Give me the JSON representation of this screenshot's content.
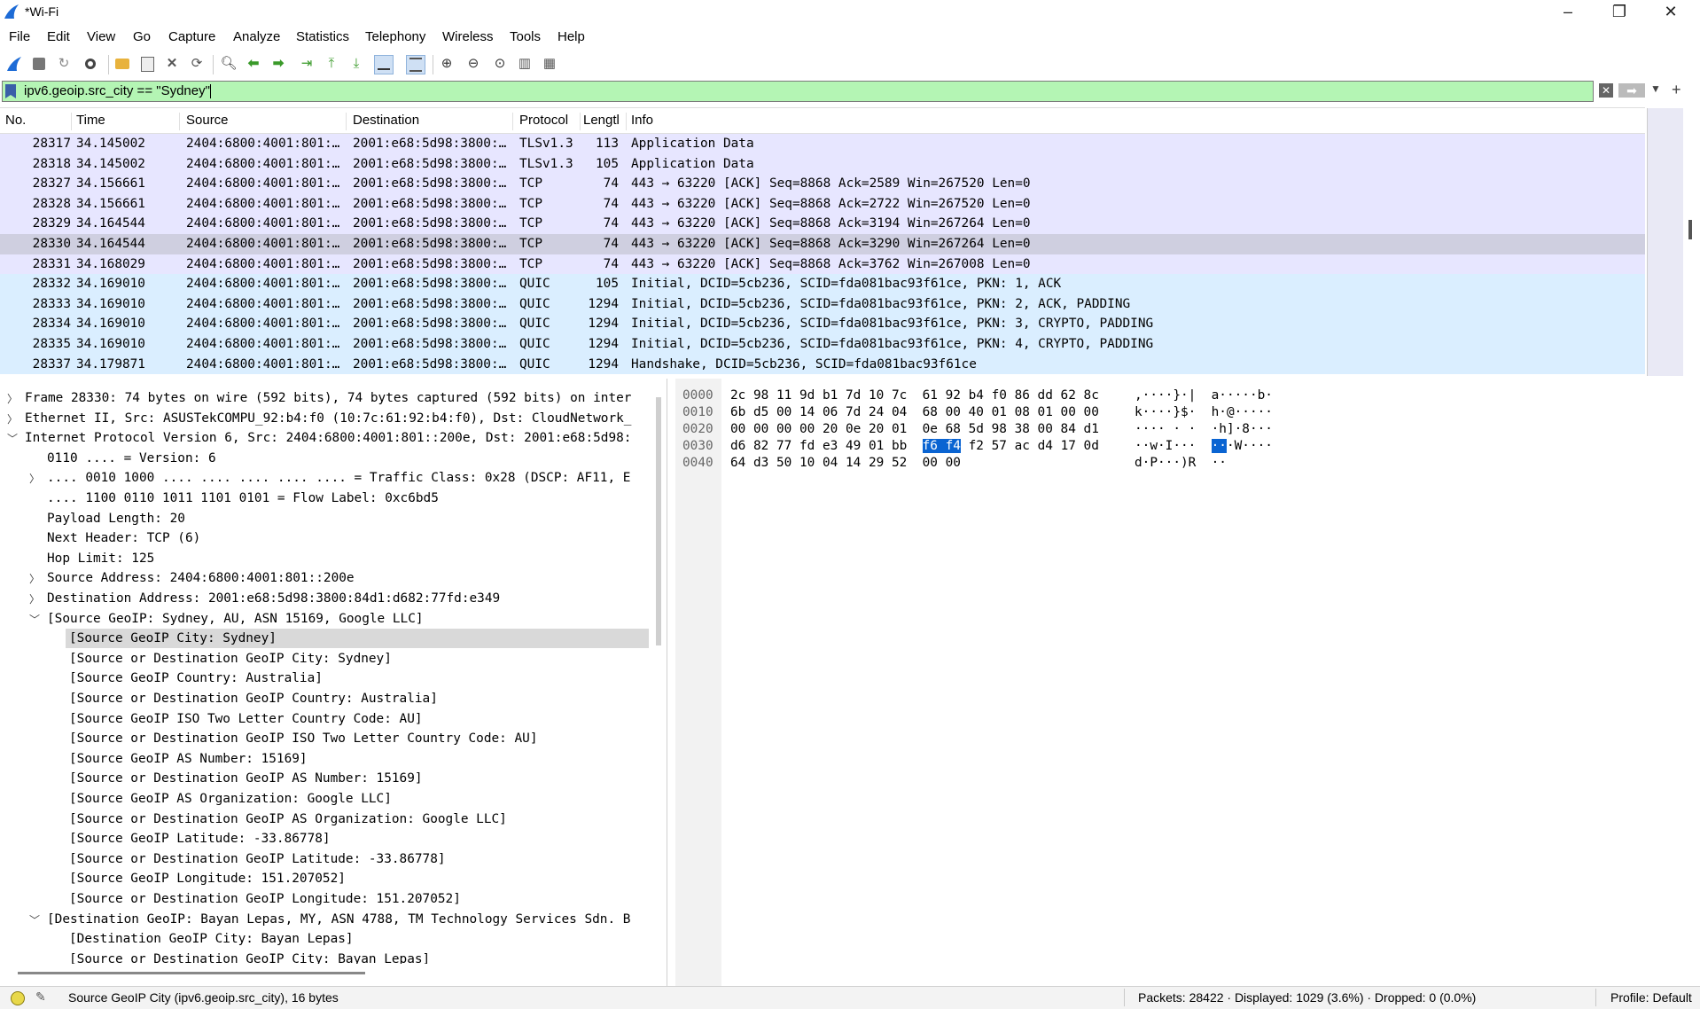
{
  "window": {
    "title": "*Wi-Fi"
  },
  "menu": [
    "File",
    "Edit",
    "View",
    "Go",
    "Capture",
    "Analyze",
    "Statistics",
    "Telephony",
    "Wireless",
    "Tools",
    "Help"
  ],
  "filter": {
    "value": "ipv6.geoip.src_city == \"Sydney\""
  },
  "columns": {
    "no": "No.",
    "time": "Time",
    "source": "Source",
    "destination": "Destination",
    "protocol": "Protocol",
    "length": "Lengtl",
    "info": "Info"
  },
  "packets": [
    {
      "no": "28317",
      "time": "34.145002",
      "src": "2404:6800:4001:801:…",
      "dst": "2001:e68:5d98:3800:…",
      "proto": "TLSv1.3",
      "len": "113",
      "info": "Application Data",
      "style": "tls"
    },
    {
      "no": "28318",
      "time": "34.145002",
      "src": "2404:6800:4001:801:…",
      "dst": "2001:e68:5d98:3800:…",
      "proto": "TLSv1.3",
      "len": "105",
      "info": "Application Data",
      "style": "tls"
    },
    {
      "no": "28327",
      "time": "34.156661",
      "src": "2404:6800:4001:801:…",
      "dst": "2001:e68:5d98:3800:…",
      "proto": "TCP",
      "len": "74",
      "info": "443 → 63220 [ACK] Seq=8868 Ack=2589 Win=267520 Len=0",
      "style": "tcp"
    },
    {
      "no": "28328",
      "time": "34.156661",
      "src": "2404:6800:4001:801:…",
      "dst": "2001:e68:5d98:3800:…",
      "proto": "TCP",
      "len": "74",
      "info": "443 → 63220 [ACK] Seq=8868 Ack=2722 Win=267520 Len=0",
      "style": "tcp"
    },
    {
      "no": "28329",
      "time": "34.164544",
      "src": "2404:6800:4001:801:…",
      "dst": "2001:e68:5d98:3800:…",
      "proto": "TCP",
      "len": "74",
      "info": "443 → 63220 [ACK] Seq=8868 Ack=3194 Win=267264 Len=0",
      "style": "tcp"
    },
    {
      "no": "28330",
      "time": "34.164544",
      "src": "2404:6800:4001:801:…",
      "dst": "2001:e68:5d98:3800:…",
      "proto": "TCP",
      "len": "74",
      "info": "443 → 63220 [ACK] Seq=8868 Ack=3290 Win=267264 Len=0",
      "style": "sel"
    },
    {
      "no": "28331",
      "time": "34.168029",
      "src": "2404:6800:4001:801:…",
      "dst": "2001:e68:5d98:3800:…",
      "proto": "TCP",
      "len": "74",
      "info": "443 → 63220 [ACK] Seq=8868 Ack=3762 Win=267008 Len=0",
      "style": "tcp"
    },
    {
      "no": "28332",
      "time": "34.169010",
      "src": "2404:6800:4001:801:…",
      "dst": "2001:e68:5d98:3800:…",
      "proto": "QUIC",
      "len": "105",
      "info": "Initial, DCID=5cb236, SCID=fda081bac93f61ce, PKN: 1, ACK",
      "style": "quic"
    },
    {
      "no": "28333",
      "time": "34.169010",
      "src": "2404:6800:4001:801:…",
      "dst": "2001:e68:5d98:3800:…",
      "proto": "QUIC",
      "len": "1294",
      "info": "Initial, DCID=5cb236, SCID=fda081bac93f61ce, PKN: 2, ACK, PADDING",
      "style": "quic"
    },
    {
      "no": "28334",
      "time": "34.169010",
      "src": "2404:6800:4001:801:…",
      "dst": "2001:e68:5d98:3800:…",
      "proto": "QUIC",
      "len": "1294",
      "info": "Initial, DCID=5cb236, SCID=fda081bac93f61ce, PKN: 3, CRYPTO, PADDING",
      "style": "quic"
    },
    {
      "no": "28335",
      "time": "34.169010",
      "src": "2404:6800:4001:801:…",
      "dst": "2001:e68:5d98:3800:…",
      "proto": "QUIC",
      "len": "1294",
      "info": "Initial, DCID=5cb236, SCID=fda081bac93f61ce, PKN: 4, CRYPTO, PADDING",
      "style": "quic"
    },
    {
      "no": "28337",
      "time": "34.179871",
      "src": "2404:6800:4001:801:…",
      "dst": "2001:e68:5d98:3800:…",
      "proto": "QUIC",
      "len": "1294",
      "info": "Handshake, DCID=5cb236, SCID=fda081bac93f61ce",
      "style": "quic"
    }
  ],
  "row_colors": {
    "tls": "#e7e6ff",
    "tcp": "#e7e6ff",
    "quic": "#daeeff",
    "sel": "#cfcfe0"
  },
  "details": [
    {
      "indent": 0,
      "arrow": "right",
      "text": "Frame 28330: 74 bytes on wire (592 bits), 74 bytes captured (592 bits) on inter"
    },
    {
      "indent": 0,
      "arrow": "right",
      "text": "Ethernet II, Src: ASUSTekCOMPU_92:b4:f0 (10:7c:61:92:b4:f0), Dst: CloudNetwork_"
    },
    {
      "indent": 0,
      "arrow": "down",
      "text": "Internet Protocol Version 6, Src: 2404:6800:4001:801::200e, Dst: 2001:e68:5d98:"
    },
    {
      "indent": 1,
      "arrow": "",
      "text": "0110 .... = Version: 6"
    },
    {
      "indent": 1,
      "arrow": "right",
      "text": ".... 0010 1000 .... .... .... .... .... = Traffic Class: 0x28 (DSCP: AF11, E"
    },
    {
      "indent": 1,
      "arrow": "",
      "text": ".... 1100 0110 1011 1101 0101 = Flow Label: 0xc6bd5"
    },
    {
      "indent": 1,
      "arrow": "",
      "text": "Payload Length: 20"
    },
    {
      "indent": 1,
      "arrow": "",
      "text": "Next Header: TCP (6)"
    },
    {
      "indent": 1,
      "arrow": "",
      "text": "Hop Limit: 125"
    },
    {
      "indent": 1,
      "arrow": "right",
      "text": "Source Address: 2404:6800:4001:801::200e"
    },
    {
      "indent": 1,
      "arrow": "right",
      "text": "Destination Address: 2001:e68:5d98:3800:84d1:d682:77fd:e349"
    },
    {
      "indent": 1,
      "arrow": "down",
      "text": "[Source GeoIP: Sydney, AU, ASN 15169, Google LLC]"
    },
    {
      "indent": 2,
      "arrow": "",
      "text": "[Source GeoIP City: Sydney]",
      "selected": true
    },
    {
      "indent": 2,
      "arrow": "",
      "text": "[Source or Destination GeoIP City: Sydney]"
    },
    {
      "indent": 2,
      "arrow": "",
      "text": "[Source GeoIP Country: Australia]"
    },
    {
      "indent": 2,
      "arrow": "",
      "text": "[Source or Destination GeoIP Country: Australia]"
    },
    {
      "indent": 2,
      "arrow": "",
      "text": "[Source GeoIP ISO Two Letter Country Code: AU]"
    },
    {
      "indent": 2,
      "arrow": "",
      "text": "[Source or Destination GeoIP ISO Two Letter Country Code: AU]"
    },
    {
      "indent": 2,
      "arrow": "",
      "text": "[Source GeoIP AS Number: 15169]"
    },
    {
      "indent": 2,
      "arrow": "",
      "text": "[Source or Destination GeoIP AS Number: 15169]"
    },
    {
      "indent": 2,
      "arrow": "",
      "text": "[Source GeoIP AS Organization: Google LLC]"
    },
    {
      "indent": 2,
      "arrow": "",
      "text": "[Source or Destination GeoIP AS Organization: Google LLC]"
    },
    {
      "indent": 2,
      "arrow": "",
      "text": "[Source GeoIP Latitude: -33.86778]"
    },
    {
      "indent": 2,
      "arrow": "",
      "text": "[Source or Destination GeoIP Latitude: -33.86778]"
    },
    {
      "indent": 2,
      "arrow": "",
      "text": "[Source GeoIP Longitude: 151.207052]"
    },
    {
      "indent": 2,
      "arrow": "",
      "text": "[Source or Destination GeoIP Longitude: 151.207052]"
    },
    {
      "indent": 1,
      "arrow": "down",
      "text": "[Destination GeoIP: Bayan Lepas, MY, ASN 4788, TM Technology Services Sdn. B"
    },
    {
      "indent": 2,
      "arrow": "",
      "text": "[Destination GeoIP City: Bayan Lepas]"
    },
    {
      "indent": 2,
      "arrow": "",
      "text": "[Source or Destination GeoIP City: Bayan Lepas]"
    }
  ],
  "bytes": [
    {
      "offset": "0000",
      "hex": "2c 98 11 9d b1 7d 10 7c  61 92 b4 f0 86 dd 62 8c",
      "ascii": ",····}·|  a·····b·"
    },
    {
      "offset": "0010",
      "hex": "6b d5 00 14 06 7d 24 04  68 00 40 01 08 01 00 00",
      "ascii": "k····}$·  h·@·····"
    },
    {
      "offset": "0020",
      "hex": "00 00 00 00 20 0e 20 01  0e 68 5d 98 38 00 84 d1",
      "ascii": "···· · ·  ·h]·8···"
    },
    {
      "offset": "0030",
      "hex_pre": "d6 82 77 fd e3 49 01 bb  ",
      "hex_hl": "f6 f4",
      "hex_post": " f2 57 ac d4 17 0d",
      "ascii_pre": "··w·I···  ",
      "ascii_hl": "··",
      "ascii_post": "·W····"
    },
    {
      "offset": "0040",
      "hex": "64 d3 50 10 04 14 29 52  00 00",
      "ascii": "d·P···)R  ··"
    }
  ],
  "status": {
    "field": "Source GeoIP City (ipv6.geoip.src_city), 16 bytes",
    "packets": "Packets: 28422 · Displayed: 1029 (3.6%) · Dropped: 0 (0.0%)",
    "profile": "Profile: Default"
  },
  "toolbar_icons": [
    "start-capture-icon",
    "stop-capture-icon",
    "restart-capture-icon",
    "capture-options-icon",
    "open-file-icon",
    "save-file-icon",
    "close-file-icon",
    "reload-file-icon",
    "find-packet-icon",
    "go-back-icon",
    "go-forward-icon",
    "go-to-packet-icon",
    "go-first-icon",
    "go-last-icon",
    "autoscroll-icon",
    "colorize-icon",
    "zoom-in-icon",
    "zoom-out-icon",
    "normal-size-icon",
    "resize-columns-icon",
    "layout-icon"
  ],
  "accent": {
    "filter_bg": "#b4f5b4",
    "highlight": "#0a64d2"
  }
}
